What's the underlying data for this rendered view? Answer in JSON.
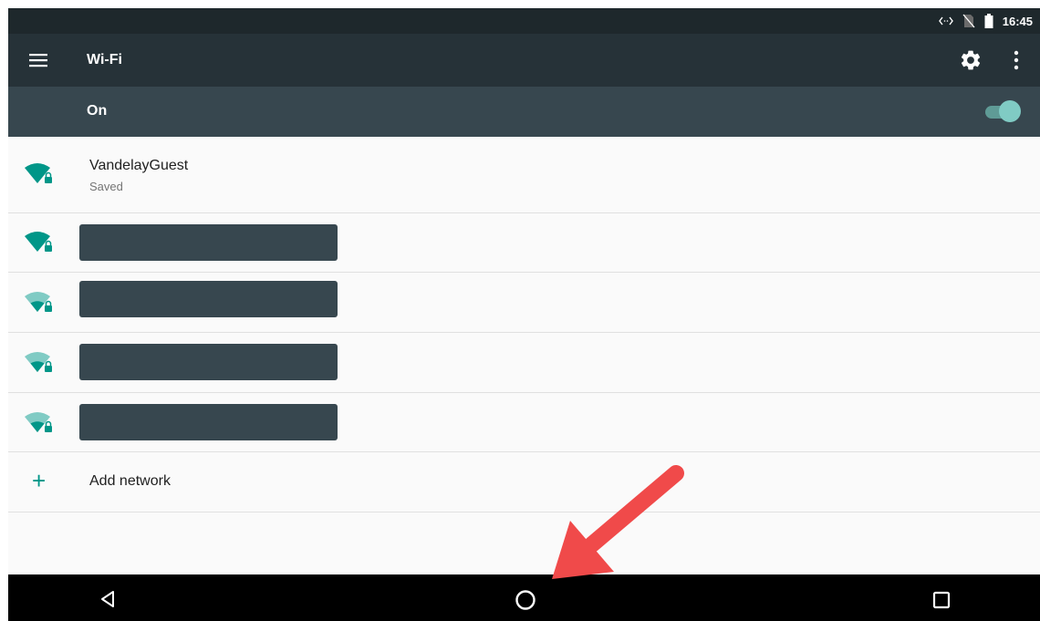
{
  "status_bar": {
    "time": "16:45",
    "icons": [
      "data-transfer-icon",
      "no-sim-icon",
      "battery-icon"
    ]
  },
  "toolbar": {
    "menu_icon": "menu-icon",
    "title": "Wi-Fi",
    "settings_icon": "gear-icon",
    "more_icon": "more-vert-icon"
  },
  "switch_bar": {
    "label": "On",
    "checked": true
  },
  "networks": [
    {
      "name": "VandelayGuest",
      "status": "Saved",
      "signal": 3,
      "secured": true,
      "redacted": false
    },
    {
      "name": "",
      "status": "",
      "signal": 3,
      "secured": true,
      "redacted": true
    },
    {
      "name": "",
      "status": "",
      "signal": 1,
      "secured": true,
      "redacted": true
    },
    {
      "name": "",
      "status": "",
      "signal": 1,
      "secured": true,
      "redacted": true
    },
    {
      "name": "",
      "status": "",
      "signal": 1,
      "secured": true,
      "redacted": true
    }
  ],
  "add_network": {
    "label": "Add network",
    "icon": "plus-icon"
  },
  "nav_bar": {
    "back_icon": "back-icon",
    "home_icon": "home-icon",
    "recents_icon": "recents-icon"
  },
  "annotation": {
    "icon": "arrow-pointer-icon",
    "color": "#f04a4a"
  },
  "colors": {
    "accent": "#009688",
    "accent_faded": "#80cbc4",
    "toolbar": "#263238",
    "switch_bar": "#37474f"
  }
}
